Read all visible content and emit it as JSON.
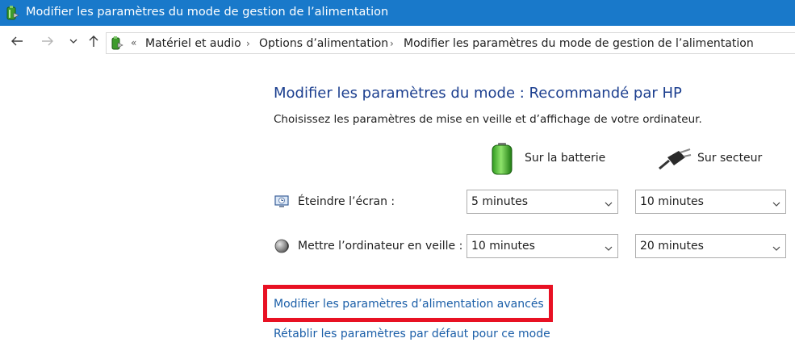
{
  "window": {
    "title": "Modifier les paramètres du mode de gestion de l’alimentation",
    "icon": "power-options-icon"
  },
  "navigation": {
    "back_icon": "arrow-left-icon",
    "forward_icon": "arrow-right-icon",
    "recent_icon": "chevron-down-icon",
    "up_icon": "arrow-up-icon"
  },
  "breadcrumb": {
    "overflow": "«",
    "items": [
      "Matériel et audio",
      "Options d’alimentation",
      "Modifier les paramètres du mode de gestion de l’alimentation"
    ],
    "separator": "›"
  },
  "main": {
    "heading": "Modifier les paramètres du mode : Recommandé par HP",
    "subtitle": "Choisissez les paramètres de mise en veille et d’affichage de votre ordinateur.",
    "columns": {
      "battery": "Sur la batterie",
      "plugged": "Sur secteur"
    },
    "settings": [
      {
        "label": "Éteindre l’écran :",
        "icon": "display-icon",
        "battery_value": "5 minutes",
        "plugged_value": "10 minutes"
      },
      {
        "label": "Mettre l’ordinateur en veille :",
        "icon": "sleep-moon-icon",
        "battery_value": "10 minutes",
        "plugged_value": "20 minutes"
      }
    ],
    "links": {
      "advanced": "Modifier les paramètres d’alimentation avancés",
      "restore": "Rétablir les paramètres par défaut pour ce mode"
    }
  },
  "colors": {
    "titlebar": "#1979ca",
    "heading": "#1c3f8f",
    "link": "#1a5ea8",
    "highlight": "#e81123"
  }
}
